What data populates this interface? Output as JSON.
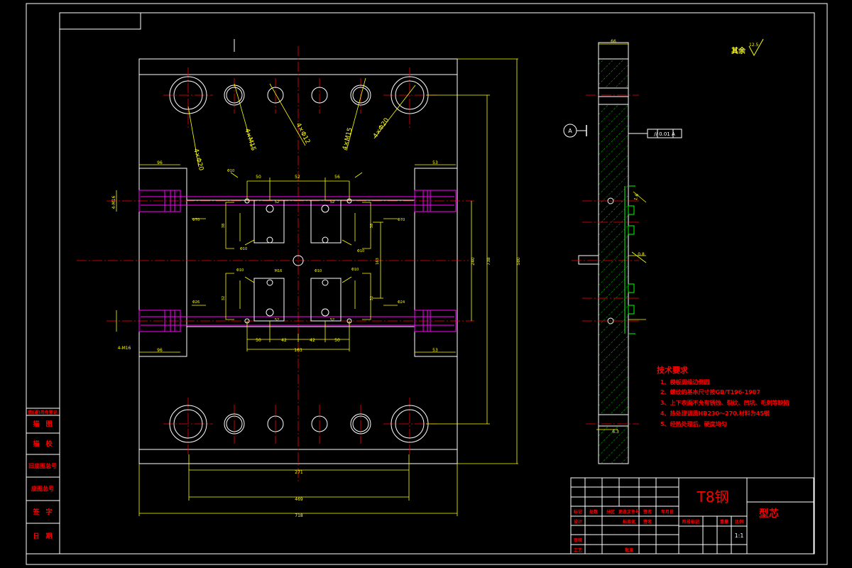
{
  "drawing": {
    "background": "#000000",
    "colors": {
      "frame": "#ffffff",
      "geometry": "#ffffff",
      "dimension": "#ffff00",
      "centerline": "#ff0000",
      "hidden": "#ff00ff",
      "hatch": "#00ff00",
      "tech_text": "#ff0000",
      "title_material": "#ff0000"
    },
    "main_view": {
      "hole_labels": [
        "4×Φ20",
        "4×M15",
        "4×Φ12",
        "4×M15",
        "4×Φ20"
      ],
      "side_port_labels": [
        "4-M16",
        "4-M16"
      ],
      "dims_top": [
        "96",
        "53"
      ],
      "dims_bottom": [
        "96",
        "53"
      ],
      "dims_inner_top": [
        "50",
        "52",
        "56"
      ],
      "dims_inner_bottom": [
        "50",
        "42",
        "42",
        "50"
      ],
      "dim_inner_bottom_total": "163",
      "dims_vertical": [
        "240",
        "738",
        "580"
      ],
      "dims_horizontal": [
        "271",
        "469",
        "718"
      ],
      "small_labels": [
        "Φ70",
        "Φ70",
        "Φ26",
        "Φ24",
        "Φ10",
        "Φ10",
        "M16",
        "Φ10",
        "Φ10",
        "Φ10",
        "Φ10",
        "52",
        "52",
        "52",
        "52",
        "38",
        "38",
        "32",
        "32",
        "163"
      ]
    },
    "side_view": {
      "width_dim": "66",
      "datum": "A",
      "tolerance": "// 0.01 A",
      "roughness_other": "其余",
      "roughness_value": "12.5",
      "roughness_small": "6.3",
      "roughness_mid": "0.8",
      "roughness_side": "1.6"
    },
    "tech_requirements": {
      "title": "技术要求",
      "items": [
        "1、模板周缘边倒圆",
        "2、螺纹的基本尺寸按GB/T196-1987",
        "3、上下表面不允有锈蚀、裂纹、凹坑、毛刺等缺陷",
        "4、热处理调质HB230～270,材料为45钢",
        "5、经热处理后，硬度均匀"
      ]
    },
    "left_strip": {
      "items": [
        "借(通)用件登记",
        "描　图",
        "描　校",
        "旧底图总号",
        "底图总号",
        "签　字",
        "日　期"
      ]
    },
    "title_block": {
      "material": "T8钢",
      "part_name": "型芯",
      "header_labels": [
        "标记",
        "处数",
        "分区",
        "更改文件号",
        "签名",
        "年月日"
      ],
      "row_labels": [
        "设计",
        "标准化",
        "签名",
        "审核",
        "工艺",
        "批准"
      ],
      "stage_labels": [
        "阶段标记",
        "重量",
        "比例"
      ],
      "scale": "1:1"
    }
  }
}
